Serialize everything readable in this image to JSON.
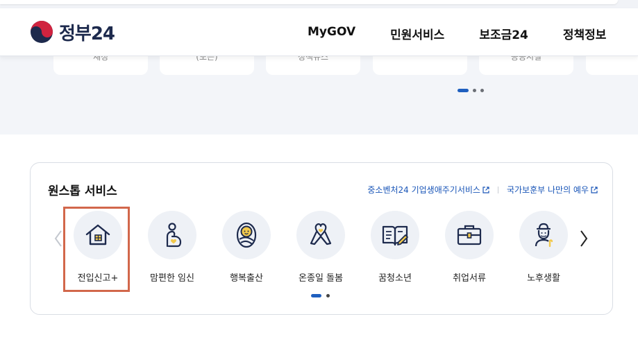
{
  "header": {
    "logo_text": "정부24",
    "nav": [
      "MyGOV",
      "민원서비스",
      "보조금24",
      "정책정보"
    ]
  },
  "banner": {
    "cards": [
      "재정",
      "(모든)",
      "정책뉴스",
      "",
      "공공시설",
      ""
    ],
    "carousel": {
      "pages": 3,
      "active": 1
    }
  },
  "onestop": {
    "title": "원스톱 서비스",
    "links": [
      "중소벤처24 기업생애주기서비스",
      "국가보훈부 나만의 예우"
    ],
    "items": [
      {
        "label": "전입신고+",
        "icon": "house-icon",
        "highlighted": true
      },
      {
        "label": "맘편한 임신",
        "icon": "pregnancy-icon"
      },
      {
        "label": "행복출산",
        "icon": "newborn-baby-icon"
      },
      {
        "label": "온종일 돌봄",
        "icon": "care-ribbon-icon"
      },
      {
        "label": "꿈청소년",
        "icon": "open-book-pencil-icon"
      },
      {
        "label": "취업서류",
        "icon": "briefcase-icon"
      },
      {
        "label": "노후생활",
        "icon": "elderly-person-icon"
      }
    ],
    "carousel": {
      "pages": 2,
      "active": 1
    },
    "colors": {
      "accent": "#1f5fbf",
      "highlight_border": "#d2674b",
      "icon_yellow": "#f2c94c",
      "icon_navy": "#1d2a4d"
    }
  }
}
